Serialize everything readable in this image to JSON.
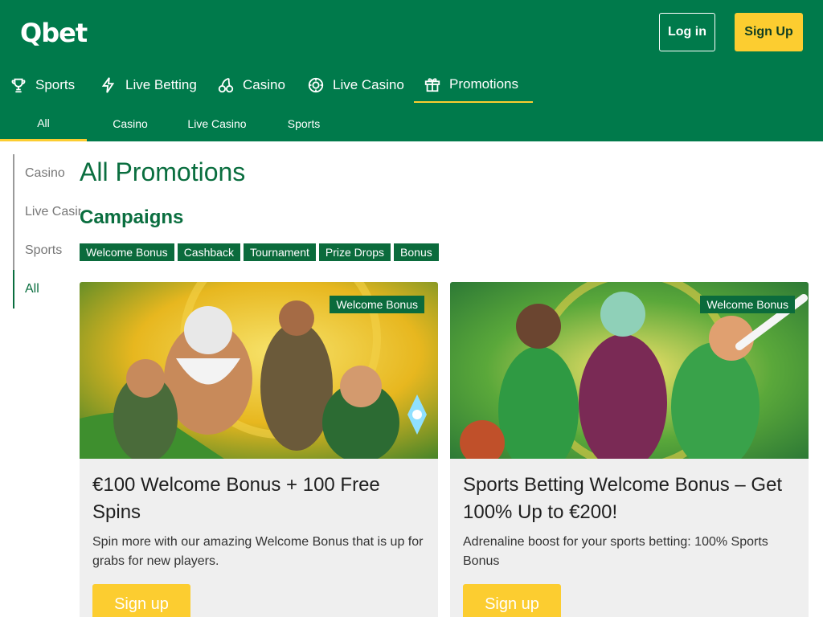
{
  "brand": {
    "logo": "Qbet"
  },
  "auth": {
    "login_label": "Log in",
    "signup_label": "Sign Up"
  },
  "main_nav": [
    {
      "label": "Sports",
      "icon": "trophy-icon"
    },
    {
      "label": "Live Betting",
      "icon": "lightning-icon"
    },
    {
      "label": "Casino",
      "icon": "cherries-icon"
    },
    {
      "label": "Live Casino",
      "icon": "roulette-icon"
    },
    {
      "label": "Promotions",
      "icon": "gift-icon",
      "active": true
    }
  ],
  "sub_nav": [
    {
      "label": "All",
      "active": true
    },
    {
      "label": "Casino"
    },
    {
      "label": "Live Casino"
    },
    {
      "label": "Sports"
    }
  ],
  "side_nav": [
    {
      "label": "Casino"
    },
    {
      "label": "Live Casino"
    },
    {
      "label": "Sports"
    },
    {
      "label": "All",
      "active": true
    }
  ],
  "page": {
    "title": "All Promotions",
    "section_title": "Campaigns"
  },
  "filters": [
    "Welcome Bonus",
    "Cashback",
    "Tournament",
    "Prize Drops",
    "Bonus"
  ],
  "cards": [
    {
      "badge": "Welcome Bonus",
      "title": "€100 Welcome Bonus + 100 Free Spins",
      "description": "Spin more with our amazing Welcome Bonus that is up for grabs for new players.",
      "button": "Sign up"
    },
    {
      "badge": "Welcome Bonus",
      "title": "Sports Betting Welcome Bonus – Get 100% Up to €200!",
      "description": "Adrenaline boost for your sports betting: 100% Sports Bonus",
      "button": "Sign up"
    }
  ],
  "colors": {
    "brand_green": "#007a4b",
    "accent_yellow": "#fccd30",
    "tag_green": "#0b6b3c",
    "title_green": "#0a6e3f"
  }
}
